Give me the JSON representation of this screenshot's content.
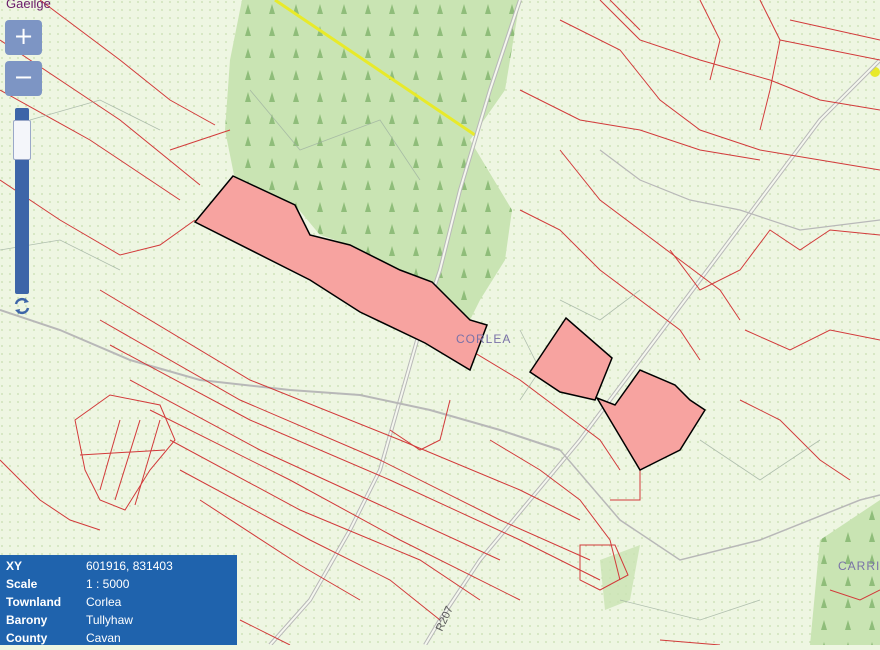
{
  "header": {
    "language_link": "Gaeilge"
  },
  "zoom": {
    "in_label": "+",
    "out_label": "−",
    "slider_level": 0.92
  },
  "labels": {
    "townland": "CORLEA",
    "road": "R207",
    "edge_townland": "CARRIG"
  },
  "info_panel": {
    "rows": [
      {
        "key": "XY",
        "value": "601916, 831403"
      },
      {
        "key": "Scale",
        "value": "1 : 5000"
      },
      {
        "key": "Townland",
        "value": "Corlea"
      },
      {
        "key": "Barony",
        "value": "Tullyhaw"
      },
      {
        "key": "County",
        "value": "Cavan"
      }
    ]
  },
  "colors": {
    "background": "#eef6e2",
    "forest": "#c9e4b3",
    "highlight_parcel": "#f7a3a0",
    "boundary": "#d23a3a",
    "road": "#b8b8b8",
    "panel": "#1f63ad",
    "rail_line": "#e8ea2a"
  },
  "icons": {
    "refresh": "refresh-icon",
    "tree": "tree-icon"
  }
}
